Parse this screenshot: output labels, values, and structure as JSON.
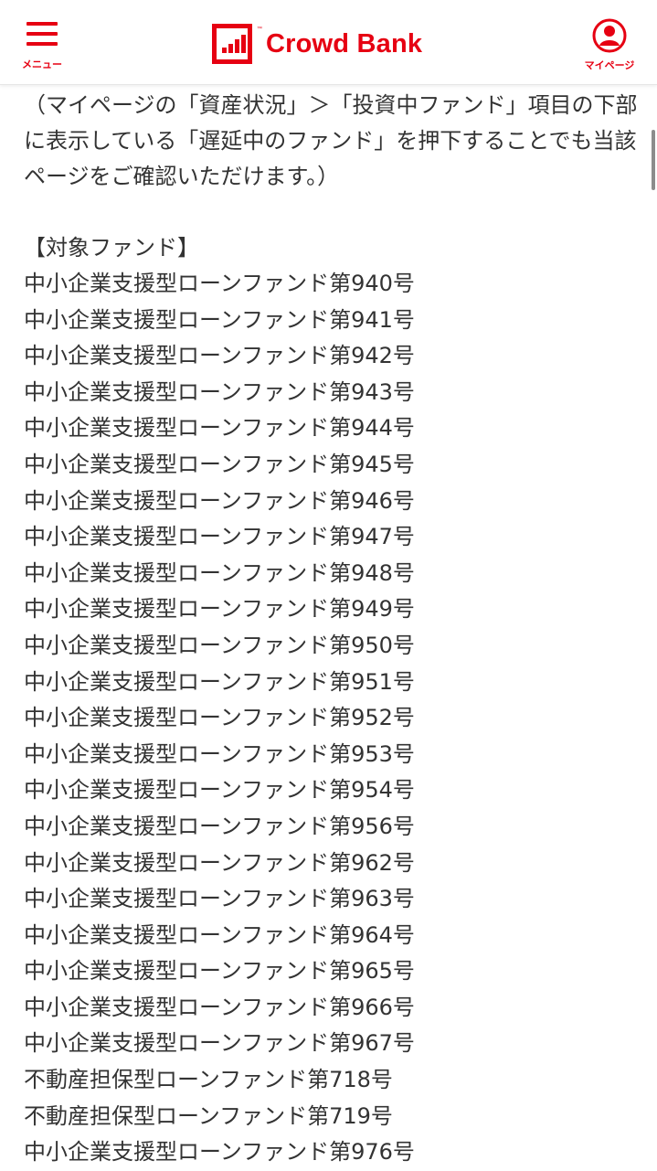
{
  "header": {
    "menu_label": "メニュー",
    "logo_text": "Crowd Bank",
    "logo_tm": "™",
    "mypage_label": "マイページ",
    "brand_color": "#e60012"
  },
  "content": {
    "intro": "（マイページの「資産状況」＞「投資中ファンド」項目の下部に表示している「遅延中のファンド」を押下することでも当該ページをご確認いただけます。）",
    "section_title": "【対象ファンド】",
    "funds": [
      "中小企業支援型ローンファンド第940号",
      "中小企業支援型ローンファンド第941号",
      "中小企業支援型ローンファンド第942号",
      "中小企業支援型ローンファンド第943号",
      "中小企業支援型ローンファンド第944号",
      "中小企業支援型ローンファンド第945号",
      "中小企業支援型ローンファンド第946号",
      "中小企業支援型ローンファンド第947号",
      "中小企業支援型ローンファンド第948号",
      "中小企業支援型ローンファンド第949号",
      "中小企業支援型ローンファンド第950号",
      "中小企業支援型ローンファンド第951号",
      "中小企業支援型ローンファンド第952号",
      "中小企業支援型ローンファンド第953号",
      "中小企業支援型ローンファンド第954号",
      "中小企業支援型ローンファンド第956号",
      "中小企業支援型ローンファンド第962号",
      "中小企業支援型ローンファンド第963号",
      "中小企業支援型ローンファンド第964号",
      "中小企業支援型ローンファンド第965号",
      "中小企業支援型ローンファンド第966号",
      "中小企業支援型ローンファンド第967号",
      "不動産担保型ローンファンド第718号",
      "不動産担保型ローンファンド第719号",
      "中小企業支援型ローンファンド第976号"
    ]
  }
}
